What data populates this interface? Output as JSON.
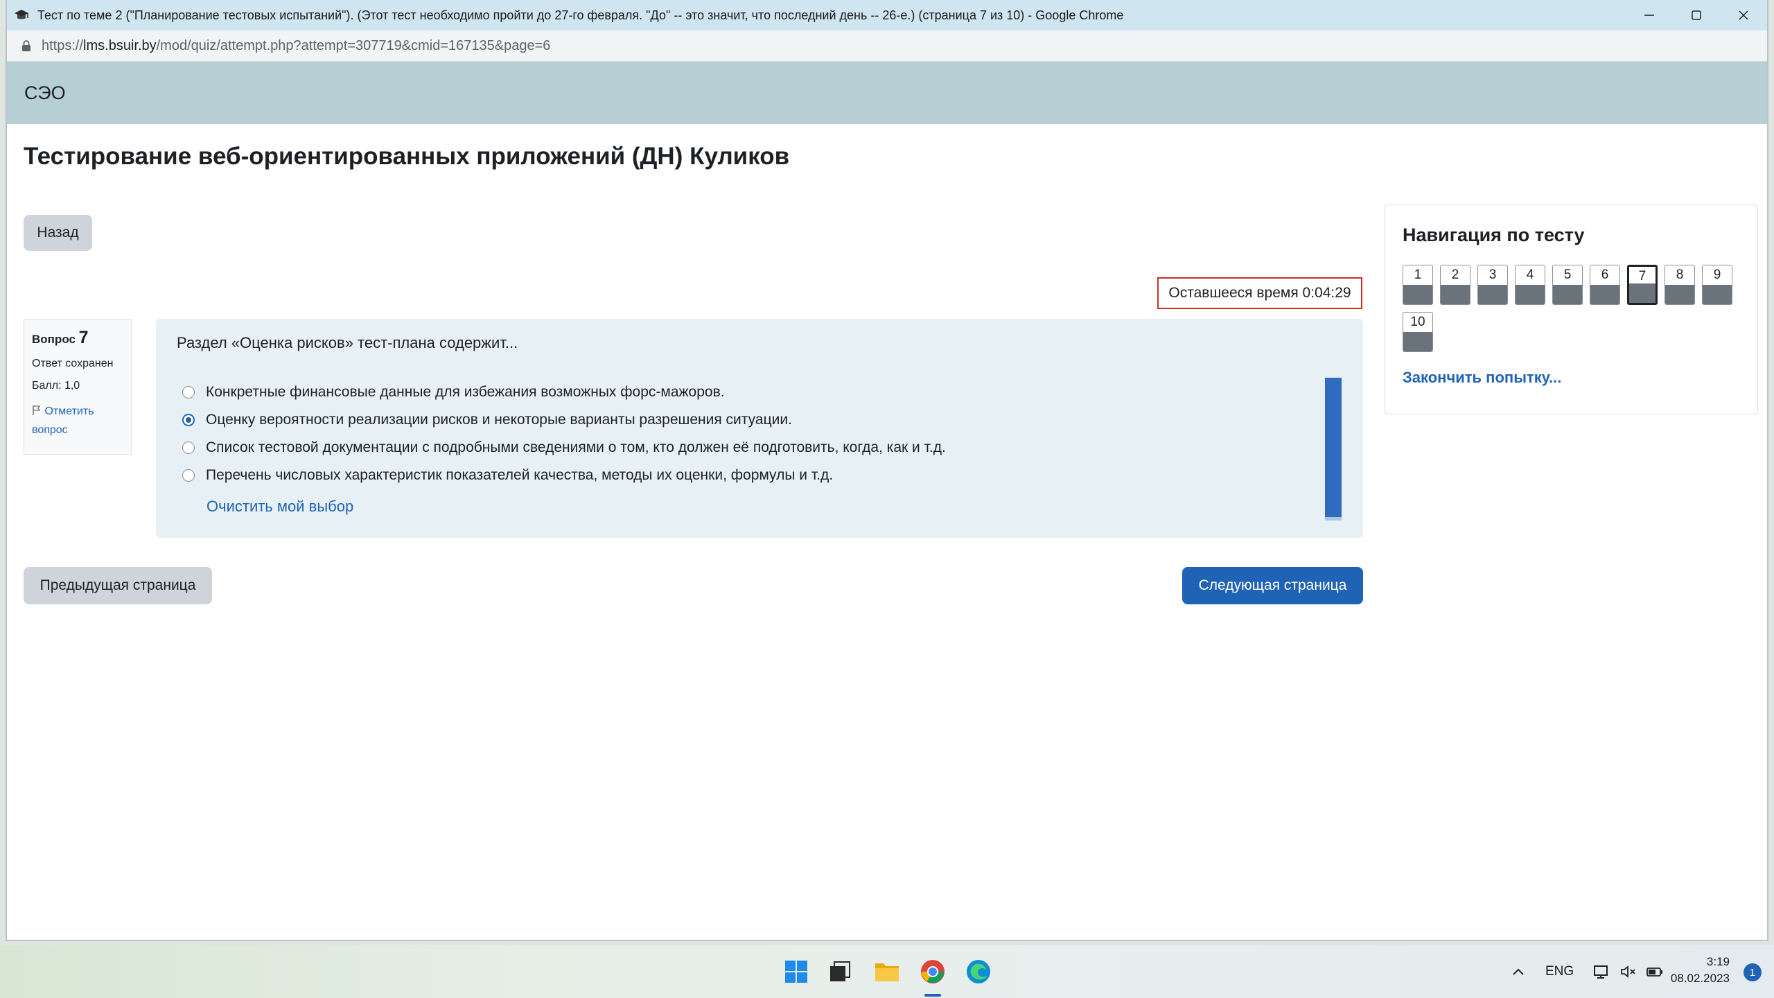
{
  "window": {
    "title": "Тест по теме 2 (\"Планирование тестовых испытаний\"). (Этот тест необходимо пройти до 27-го февраля. \"До\" -- это значит, что последний день -- 26-е.) (страница 7 из 10) - Google Chrome"
  },
  "address": {
    "host": "lms.bsuir.by",
    "path": "/mod/quiz/attempt.php?attempt=307719&cmid=167135&page=6",
    "prefix": "https://"
  },
  "site": {
    "brand": "СЭО"
  },
  "page": {
    "title": "Тестирование веб-ориентированных приложений (ДН) Куликов",
    "back_label": "Назад",
    "timer": "Оставшееся время 0:04:29",
    "prev_label": "Предыдущая страница",
    "next_label": "Следующая страница"
  },
  "question": {
    "label": "Вопрос",
    "number": "7",
    "status": "Ответ сохранен",
    "score": "Балл: 1,0",
    "flag_label": "Отметить вопрос",
    "text": "Раздел «Оценка рисков» тест-плана содержит...",
    "options": [
      "Конкретные финансовые данные для избежания возможных форс-мажоров.",
      "Оценку вероятности реализации рисков и некоторые варианты разрешения ситуации.",
      "Список тестовой документации с подробными сведениями о том, кто должен её подготовить, когда, как и т.д.",
      "Перечень числовых характеристик показателей качества, методы их оценки, формулы и т.д."
    ],
    "selected_index": 1,
    "clear_label": "Очистить мой выбор"
  },
  "navigation": {
    "title": "Навигация по тесту",
    "buttons": [
      "1",
      "2",
      "3",
      "4",
      "5",
      "6",
      "7",
      "8",
      "9",
      "10"
    ],
    "current": "7",
    "finish_label": "Закончить попытку..."
  },
  "taskbar": {
    "icons": [
      "windows-start-icon",
      "task-view-icon",
      "file-explorer-icon",
      "chrome-icon",
      "edge-icon"
    ],
    "lang": "ENG",
    "time": "3:19",
    "date": "08.02.2023",
    "notifications": "1"
  },
  "colors": {
    "header_bg": "#b6cfd4",
    "primary": "#1f63b6",
    "timer_border": "#ca3120",
    "question_bg": "#e7f1f5"
  }
}
